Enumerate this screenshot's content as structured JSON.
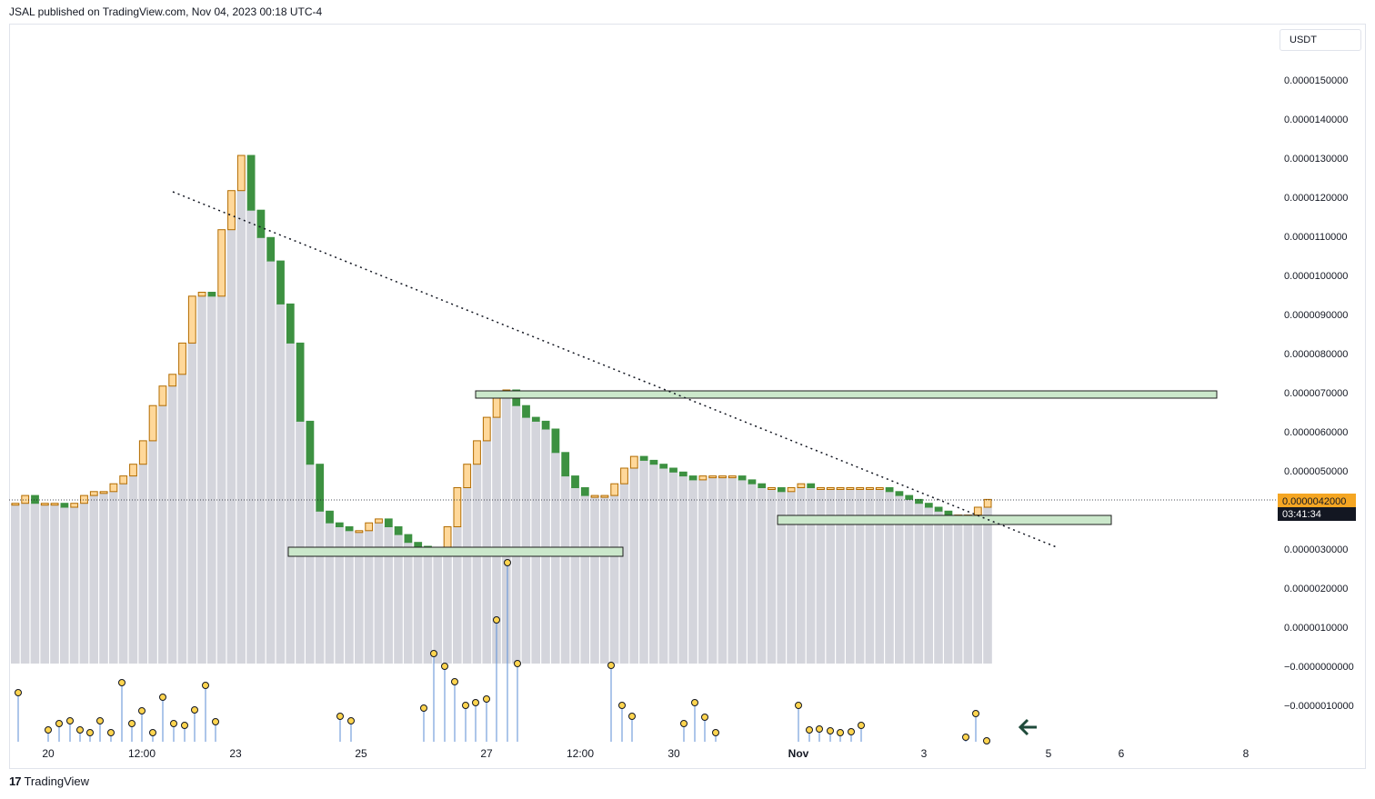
{
  "header": {
    "published": "JSAL published on TradingView.com, Nov 04, 2023 00:18 UTC-4"
  },
  "currency": "USDT",
  "brand": {
    "logo": "17",
    "name": "TradingView"
  },
  "price_badge": {
    "price": "0.0000042000",
    "countdown": "03:41:34"
  },
  "colors": {
    "up_body": "#ffd89a",
    "up_border": "#b26c00",
    "down_body": "#3d9141",
    "volume": "#d4d5dc",
    "zone_fill": "#cbe8cb",
    "zone_border": "#1d1d1d",
    "badge": "#f5a623",
    "countdown_bg": "#131722",
    "pin": "#ffd54f",
    "stem": "#5b8ed6"
  },
  "annotations": [
    {
      "type": "dotted-trendline",
      "from": [
        "Oct 22 03:00",
        1.2e-05
      ],
      "to": [
        "Nov 4 09:00",
        3e-06
      ]
    },
    {
      "type": "zone",
      "from": "Oct 27 00:00",
      "to": "Nov 3 12:00",
      "top": 7e-06,
      "bottom": 6.9e-06
    },
    {
      "type": "zone",
      "from": "Oct 24 00:00",
      "to": "Oct 29 00:00",
      "top": 3e-06,
      "bottom": 2.8e-06
    },
    {
      "type": "zone",
      "from": "Oct 31 06:00",
      "to": "Nov 4 12:00",
      "top": 3.8e-06,
      "bottom": 3.6e-06
    }
  ],
  "arrow_icon": "arrow-left-icon",
  "chart_data": {
    "type": "candlestick",
    "title": "",
    "ylim": [
      -1.5e-06,
      1.6e-05
    ],
    "y_ticks": [
      "0.0000150000",
      "0.0000140000",
      "0.0000130000",
      "0.0000120000",
      "0.0000110000",
      "0.0000100000",
      "0.0000090000",
      "0.0000080000",
      "0.0000070000",
      "0.0000060000",
      "0.0000050000",
      "0.0000040000",
      "0.0000030000",
      "0.0000020000",
      "0.0000010000",
      "−0.0000000000",
      "−0.0000010000"
    ],
    "x_ticks": [
      "20",
      "12:00",
      "23",
      "25",
      "27",
      "12:00",
      "30",
      "Nov",
      "3",
      "5",
      "6",
      "8"
    ],
    "grid": false,
    "candles_close": [
      4.1,
      4.3,
      4.1,
      4.1,
      4.1,
      4.0,
      4.1,
      4.3,
      4.4,
      4.4,
      4.6,
      4.8,
      5.1,
      5.7,
      6.6,
      7.1,
      7.4,
      8.2,
      9.4,
      9.5,
      9.4,
      11.1,
      12.1,
      13.0,
      11.6,
      10.9,
      10.3,
      9.2,
      8.2,
      6.2,
      5.1,
      3.9,
      3.6,
      3.5,
      3.4,
      3.4,
      3.6,
      3.7,
      3.5,
      3.3,
      3.1,
      3.0,
      2.9,
      2.9,
      3.5,
      4.5,
      5.1,
      5.7,
      6.3,
      6.9,
      7.0,
      6.6,
      6.3,
      6.2,
      6.0,
      5.4,
      4.8,
      4.5,
      4.3,
      4.3,
      4.3,
      4.6,
      5.0,
      5.3,
      5.2,
      5.1,
      5.0,
      4.9,
      4.8,
      4.7,
      4.8,
      4.8,
      4.8,
      4.8,
      4.7,
      4.6,
      4.5,
      4.5,
      4.4,
      4.5,
      4.6,
      4.5,
      4.5,
      4.5,
      4.5,
      4.5,
      4.5,
      4.5,
      4.5,
      4.4,
      4.3,
      4.2,
      4.1,
      4.0,
      3.9,
      3.8,
      3.8,
      3.8,
      4.0,
      4.2
    ],
    "volume_count": 100,
    "pins": [
      {
        "x": "Oct 19 12:00",
        "v": -7e-07
      },
      {
        "x": "Oct 20 00:00",
        "v": -1.4e-06
      },
      {
        "x": "Oct 20 06:00",
        "v": -1.2e-06
      },
      {
        "x": "Oct 21 09:00",
        "v": -3e-07
      },
      {
        "x": "Oct 22 12:00",
        "v": -5e-07
      },
      {
        "x": "Oct 24 18:00",
        "v": -1.1e-06
      },
      {
        "x": "Oct 26 09:00",
        "v": -1e-07
      },
      {
        "x": "Oct 27 12:00",
        "v": 1.1e-06
      },
      {
        "x": "Oct 27 18:00",
        "v": 2.6e-06
      },
      {
        "x": "Oct 28 00:00",
        "v": 0.0
      },
      {
        "x": "Oct 29 00:00",
        "v": 0.0
      },
      {
        "x": "Oct 30 18:00",
        "v": -1e-06
      },
      {
        "x": "Nov 1 00:00",
        "v": -1e-06
      },
      {
        "x": "Nov 3 18:00",
        "v": -1.2e-06
      }
    ]
  }
}
